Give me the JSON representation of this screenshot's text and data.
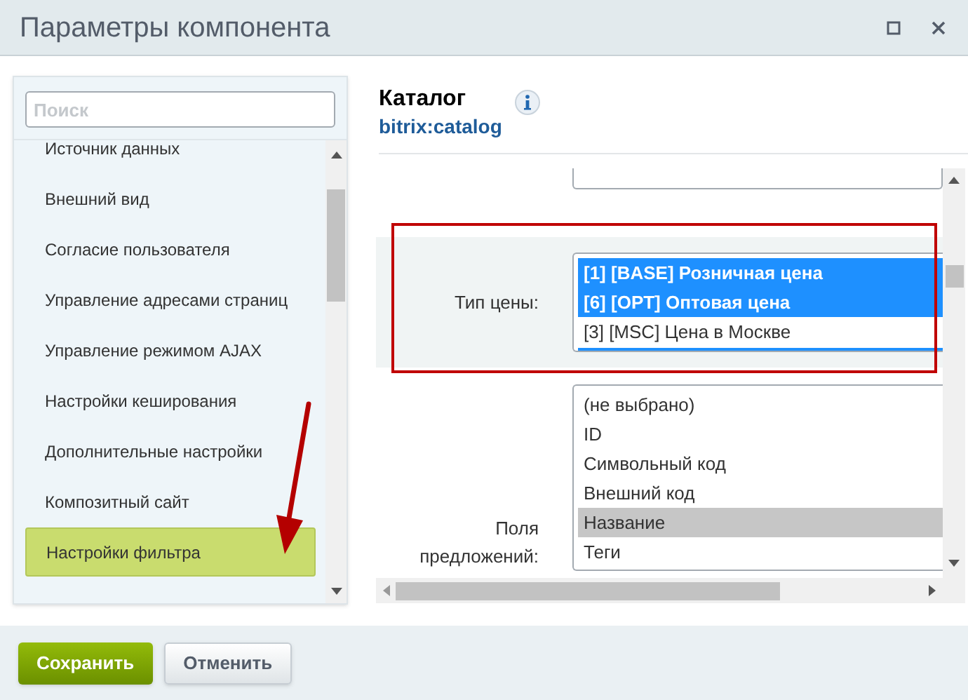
{
  "window": {
    "title": "Параметры компонента"
  },
  "sidebar": {
    "search": {
      "placeholder": "Поиск"
    },
    "items": [
      {
        "label": "Источник данных",
        "selected": false
      },
      {
        "label": "Внешний вид",
        "selected": false
      },
      {
        "label": "Согласие пользователя",
        "selected": false
      },
      {
        "label": "Управление адресами страниц",
        "selected": false
      },
      {
        "label": "Управление режимом AJAX",
        "selected": false
      },
      {
        "label": "Настройки кеширования",
        "selected": false
      },
      {
        "label": "Дополнительные настройки",
        "selected": false
      },
      {
        "label": "Композитный сайт",
        "selected": false
      },
      {
        "label": "Настройки фильтра",
        "selected": true
      }
    ]
  },
  "component": {
    "title": "Каталог",
    "code": "bitrix:catalog"
  },
  "fields": [
    {
      "label": "Тип цены:",
      "highlighted": true,
      "options": [
        {
          "label": "[1] [BASE] Розничная цена",
          "selected": true
        },
        {
          "label": "[6] [OPT] Оптовая цена",
          "selected": true
        },
        {
          "label": "[3] [MSC] Цена в Москве",
          "selected": false
        }
      ]
    },
    {
      "label": "Поля предложений:",
      "highlighted": false,
      "options": [
        {
          "label": "(не выбрано)",
          "selected": false
        },
        {
          "label": "ID",
          "selected": false
        },
        {
          "label": "Символьный код",
          "selected": false
        },
        {
          "label": "Внешний код",
          "selected": false
        },
        {
          "label": "Название",
          "selected": true
        },
        {
          "label": "Теги",
          "selected": false
        }
      ]
    }
  ],
  "buttons": [
    {
      "label": "Сохранить",
      "kind": "primary"
    },
    {
      "label": "Отменить",
      "kind": "secondary"
    }
  ]
}
